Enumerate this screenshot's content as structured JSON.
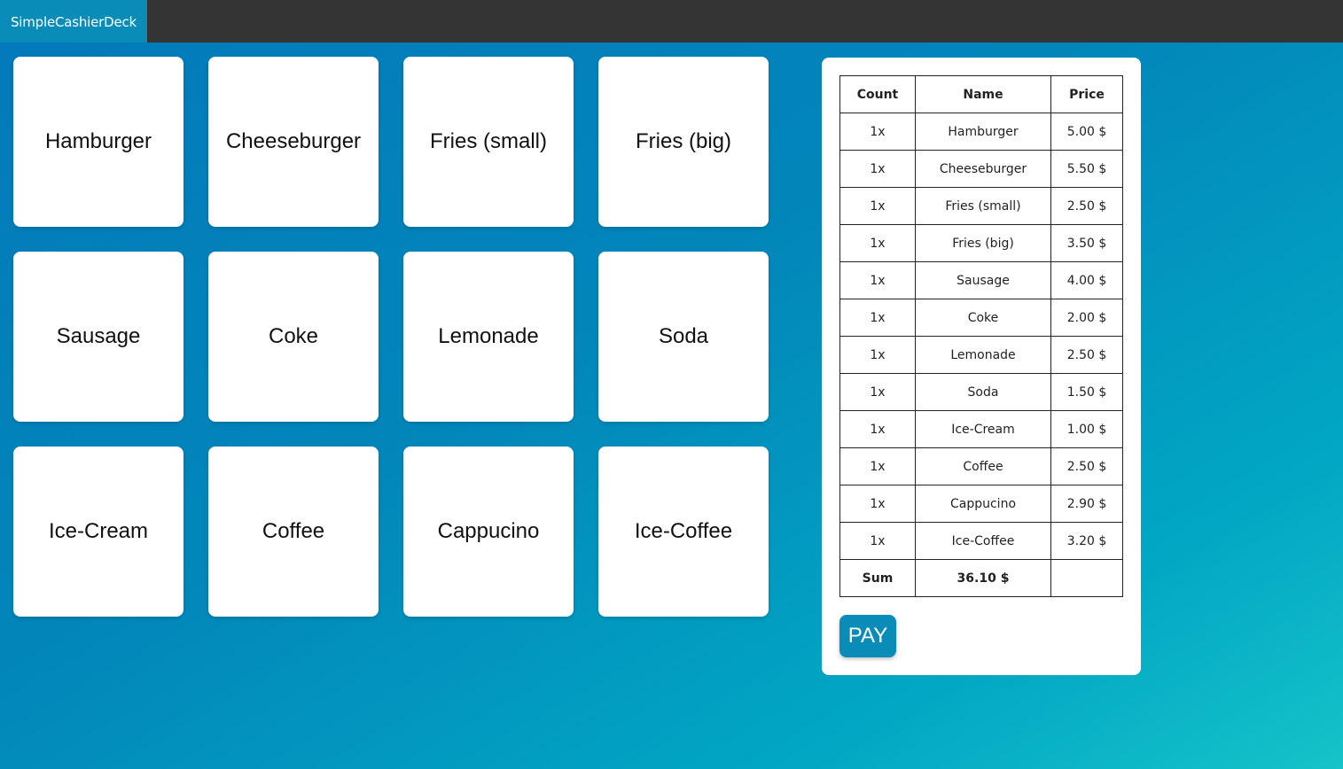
{
  "app": {
    "title": "SimpleCashierDeck"
  },
  "products": [
    "Hamburger",
    "Cheeseburger",
    "Fries (small)",
    "Fries (big)",
    "Sausage",
    "Coke",
    "Lemonade",
    "Soda",
    "Ice-Cream",
    "Coffee",
    "Cappucino",
    "Ice-Coffee"
  ],
  "cart": {
    "headers": {
      "count": "Count",
      "name": "Name",
      "price": "Price"
    },
    "rows": [
      {
        "count": "1x",
        "name": "Hamburger",
        "price": "5.00 $"
      },
      {
        "count": "1x",
        "name": "Cheeseburger",
        "price": "5.50 $"
      },
      {
        "count": "1x",
        "name": "Fries (small)",
        "price": "2.50 $"
      },
      {
        "count": "1x",
        "name": "Fries (big)",
        "price": "3.50 $"
      },
      {
        "count": "1x",
        "name": "Sausage",
        "price": "4.00 $"
      },
      {
        "count": "1x",
        "name": "Coke",
        "price": "2.00 $"
      },
      {
        "count": "1x",
        "name": "Lemonade",
        "price": "2.50 $"
      },
      {
        "count": "1x",
        "name": "Soda",
        "price": "1.50 $"
      },
      {
        "count": "1x",
        "name": "Ice-Cream",
        "price": "1.00 $"
      },
      {
        "count": "1x",
        "name": "Coffee",
        "price": "2.50 $"
      },
      {
        "count": "1x",
        "name": "Cappucino",
        "price": "2.90 $"
      },
      {
        "count": "1x",
        "name": "Ice-Coffee",
        "price": "3.20 $"
      }
    ],
    "sum_label": "Sum",
    "sum_value": "36.10 $",
    "pay_label": "PAY"
  },
  "colors": {
    "accent": "#0a8cb8",
    "topbar": "#343434",
    "background_start": "#0379bb",
    "background_end": "#15c3c8"
  }
}
